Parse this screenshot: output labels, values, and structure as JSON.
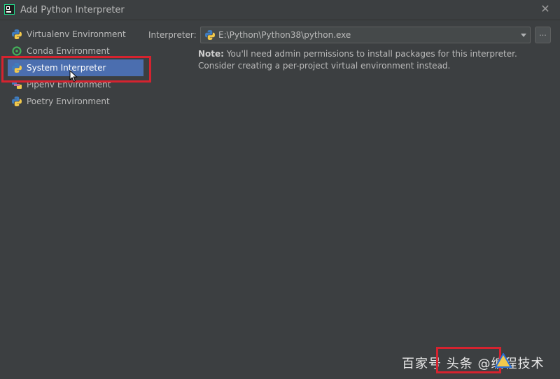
{
  "window": {
    "title": "Add Python Interpreter"
  },
  "sidebar": {
    "items": [
      {
        "label": "Virtualenv Environment",
        "icon": "python-icon"
      },
      {
        "label": "Conda Environment",
        "icon": "conda-icon"
      },
      {
        "label": "System Interpreter",
        "icon": "python-icon",
        "selected": true
      },
      {
        "label": "Pipenv Environment",
        "icon": "pipenv-icon"
      },
      {
        "label": "Poetry Environment",
        "icon": "python-icon"
      }
    ]
  },
  "main": {
    "interpreter_label": "Interpreter:",
    "interpreter_value": "E:\\Python\\Python38\\python.exe",
    "browse_label": "...",
    "note_prefix": "Note:",
    "note_text": "You'll need admin permissions to install packages for this interpreter. Consider creating a per-project virtual environment instead."
  },
  "watermark": {
    "text": "百家号 头条 @编程技术"
  },
  "colors": {
    "background": "#3c3f41",
    "selection": "#4b6eaf",
    "highlight": "#d5232f"
  }
}
